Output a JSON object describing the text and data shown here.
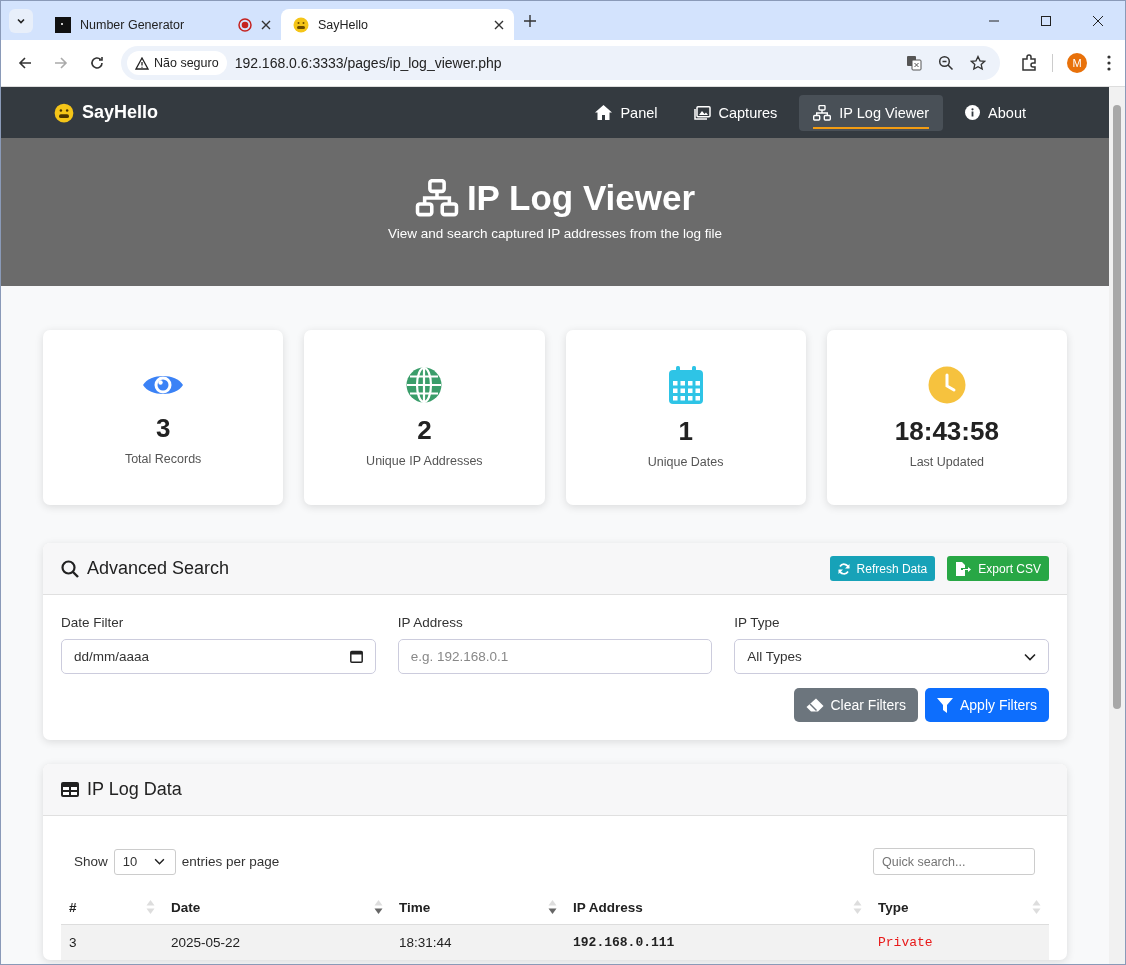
{
  "browser": {
    "tabs": [
      {
        "title": "Number Generator",
        "selected": false,
        "recording": true
      },
      {
        "title": "SayHello",
        "selected": true,
        "recording": false
      }
    ],
    "security": "Não seguro",
    "url": "192.168.0.6:3333/pages/ip_log_viewer.php",
    "profile": "M"
  },
  "navbar": {
    "brand": "SayHello",
    "items": [
      {
        "label": "Panel",
        "kind": "home",
        "selected": false
      },
      {
        "label": "Captures",
        "kind": "images",
        "selected": false
      },
      {
        "label": "IP Log Viewer",
        "kind": "network",
        "selected": true
      },
      {
        "label": "About",
        "kind": "info",
        "selected": false
      }
    ]
  },
  "hero": {
    "title": "IP Log Viewer",
    "subtitle": "View and search captured IP addresses from the log file"
  },
  "stats": [
    {
      "kind": "eye",
      "color": "#3b82f6",
      "value": "3",
      "label": "Total Records"
    },
    {
      "kind": "globe",
      "color": "#3a9d6a",
      "value": "2",
      "label": "Unique IP Addresses"
    },
    {
      "kind": "calendar",
      "color": "#2ec4e6",
      "value": "1",
      "label": "Unique Dates"
    },
    {
      "kind": "clock",
      "color": "#f6c23e",
      "value": "18:43:58",
      "label": "Last Updated"
    }
  ],
  "search": {
    "title": "Advanced Search",
    "refresh": "Refresh Data",
    "export": "Export CSV",
    "date_label": "Date Filter",
    "date_value": "dd/mm/aaaa",
    "ip_label": "IP Address",
    "ip_placeholder": "e.g. 192.168.0.1",
    "type_label": "IP Type",
    "type_value": "All Types",
    "clear": "Clear Filters",
    "apply": "Apply Filters"
  },
  "log": {
    "title": "IP Log Data",
    "show": "Show",
    "page_size": "10",
    "per_page": "entries per page",
    "quick_search_placeholder": "Quick search...",
    "columns": [
      {
        "label": "#",
        "sorted": false
      },
      {
        "label": "Date",
        "sorted": true
      },
      {
        "label": "Time",
        "sorted": true
      },
      {
        "label": "IP Address",
        "sorted": false
      },
      {
        "label": "Type",
        "sorted": false
      }
    ],
    "rows": [
      {
        "num": "3",
        "date": "2025-05-22",
        "time": "18:31:44",
        "ip": "192.168.0.111",
        "type": "Private"
      }
    ]
  }
}
